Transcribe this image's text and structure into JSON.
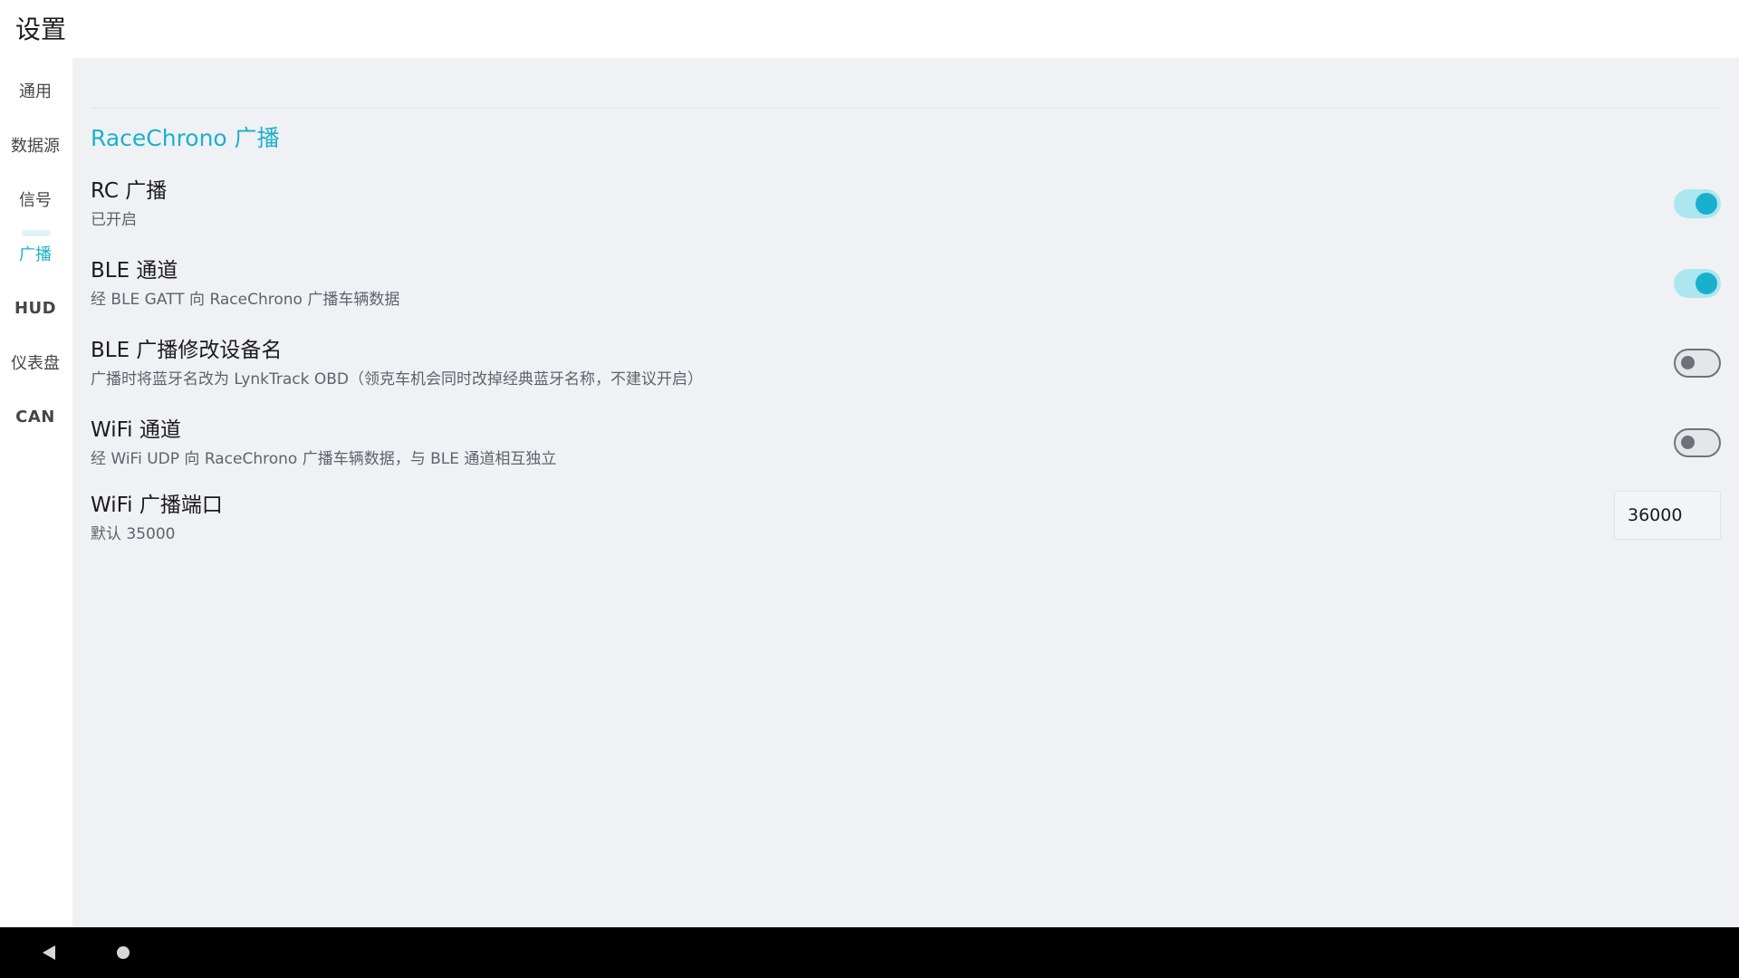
{
  "app": {
    "title": "设置"
  },
  "rail": {
    "items": [
      {
        "label": "通用"
      },
      {
        "label": "数据源"
      },
      {
        "label": "信号"
      },
      {
        "label": "广播"
      },
      {
        "label": "HUD"
      },
      {
        "label": "仪表盘"
      },
      {
        "label": "CAN"
      }
    ],
    "active": "广播"
  },
  "section": {
    "title": "RaceChrono 广播"
  },
  "settings": [
    {
      "title": "RC 广播",
      "subtitle": "已开启",
      "control": "toggle",
      "enabled": true
    },
    {
      "title": "BLE 通道",
      "subtitle": "经 BLE GATT 向 RaceChrono 广播车辆数据",
      "control": "toggle",
      "enabled": true
    },
    {
      "title": "BLE 广播修改设备名",
      "subtitle": "广播时将蓝牙名改为 LynkTrack OBD（领克车机会同时改掉经典蓝牙名称，不建议开启）",
      "control": "toggle",
      "enabled": false
    },
    {
      "title": "WiFi 通道",
      "subtitle": "经 WiFi UDP 向 RaceChrono 广播车辆数据，与 BLE 通道相互独立",
      "control": "toggle",
      "enabled": false
    },
    {
      "title": "WiFi 广播端口",
      "subtitle": "默认 35000",
      "control": "number-input",
      "value": "36000"
    }
  ],
  "colors": {
    "accent": "#1bb1cc",
    "toggle_on_track": "#aee6ef",
    "toggle_off_outline": "#6f7378",
    "content_background": "#f0f1f4"
  },
  "navbar": {
    "icons": [
      "back-icon",
      "home-icon"
    ]
  }
}
